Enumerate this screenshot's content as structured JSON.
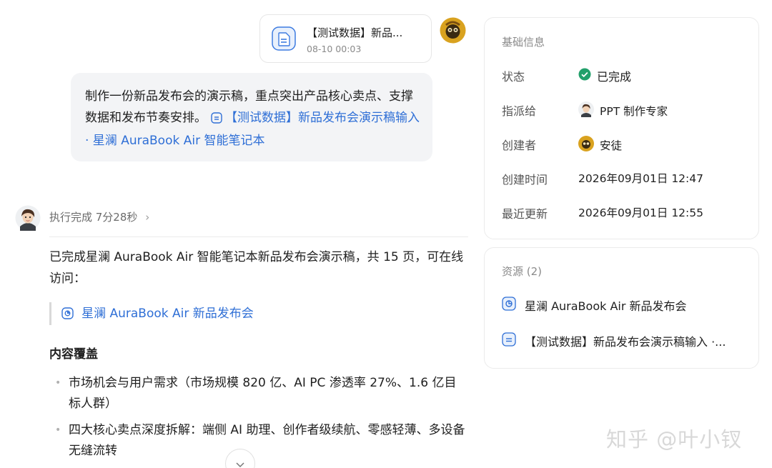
{
  "file_card": {
    "title": "【测试数据】新品...",
    "date": "08-10 00:03",
    "icon": "document-icon"
  },
  "user_message": {
    "text": "制作一份新品发布会的演示稿，重点突出产品核心卖点、支撑数据和发布节奏安排。",
    "link_text": "【测试数据】新品发布会演示稿输入 · 星澜 AuraBook Air 智能笔记本"
  },
  "execution": {
    "status": "执行完成 7分28秒",
    "chevron": "›"
  },
  "response": {
    "summary": "已完成星澜 AuraBook Air 智能笔记本新品发布会演示稿，共 15 页，可在线访问：",
    "link_text": "星澜 AuraBook Air 新品发布会",
    "heading": "内容覆盖",
    "bullets": [
      "市场机会与用户需求（市场规模 820 亿、AI PC 渗透率 27%、1.6 亿目标人群）",
      "四大核心卖点深度拆解：端侧 AI 助理、创作者级续航、零感轻薄、多设备无缝流转"
    ]
  },
  "info_panel": {
    "title": "基础信息",
    "status_label": "状态",
    "status_value": "已完成",
    "assignee_label": "指派给",
    "assignee_value": "PPT 制作专家",
    "creator_label": "创建者",
    "creator_value": "安徒",
    "created_label": "创建时间",
    "created_value": "2026年09月01日 12:47",
    "updated_label": "最近更新",
    "updated_value": "2026年09月01日 12:55"
  },
  "resources": {
    "title": "资源 (2)",
    "items": [
      {
        "label": "星澜 AuraBook Air 新品发布会",
        "icon": "presentation-icon"
      },
      {
        "label": "【测试数据】新品发布会演示稿输入 ·...",
        "icon": "document-icon"
      }
    ]
  },
  "watermark": "知乎 @叶小钗",
  "colors": {
    "link": "#2f6fd6",
    "success": "#22a06b",
    "bubble_bg": "#f3f4f6"
  }
}
